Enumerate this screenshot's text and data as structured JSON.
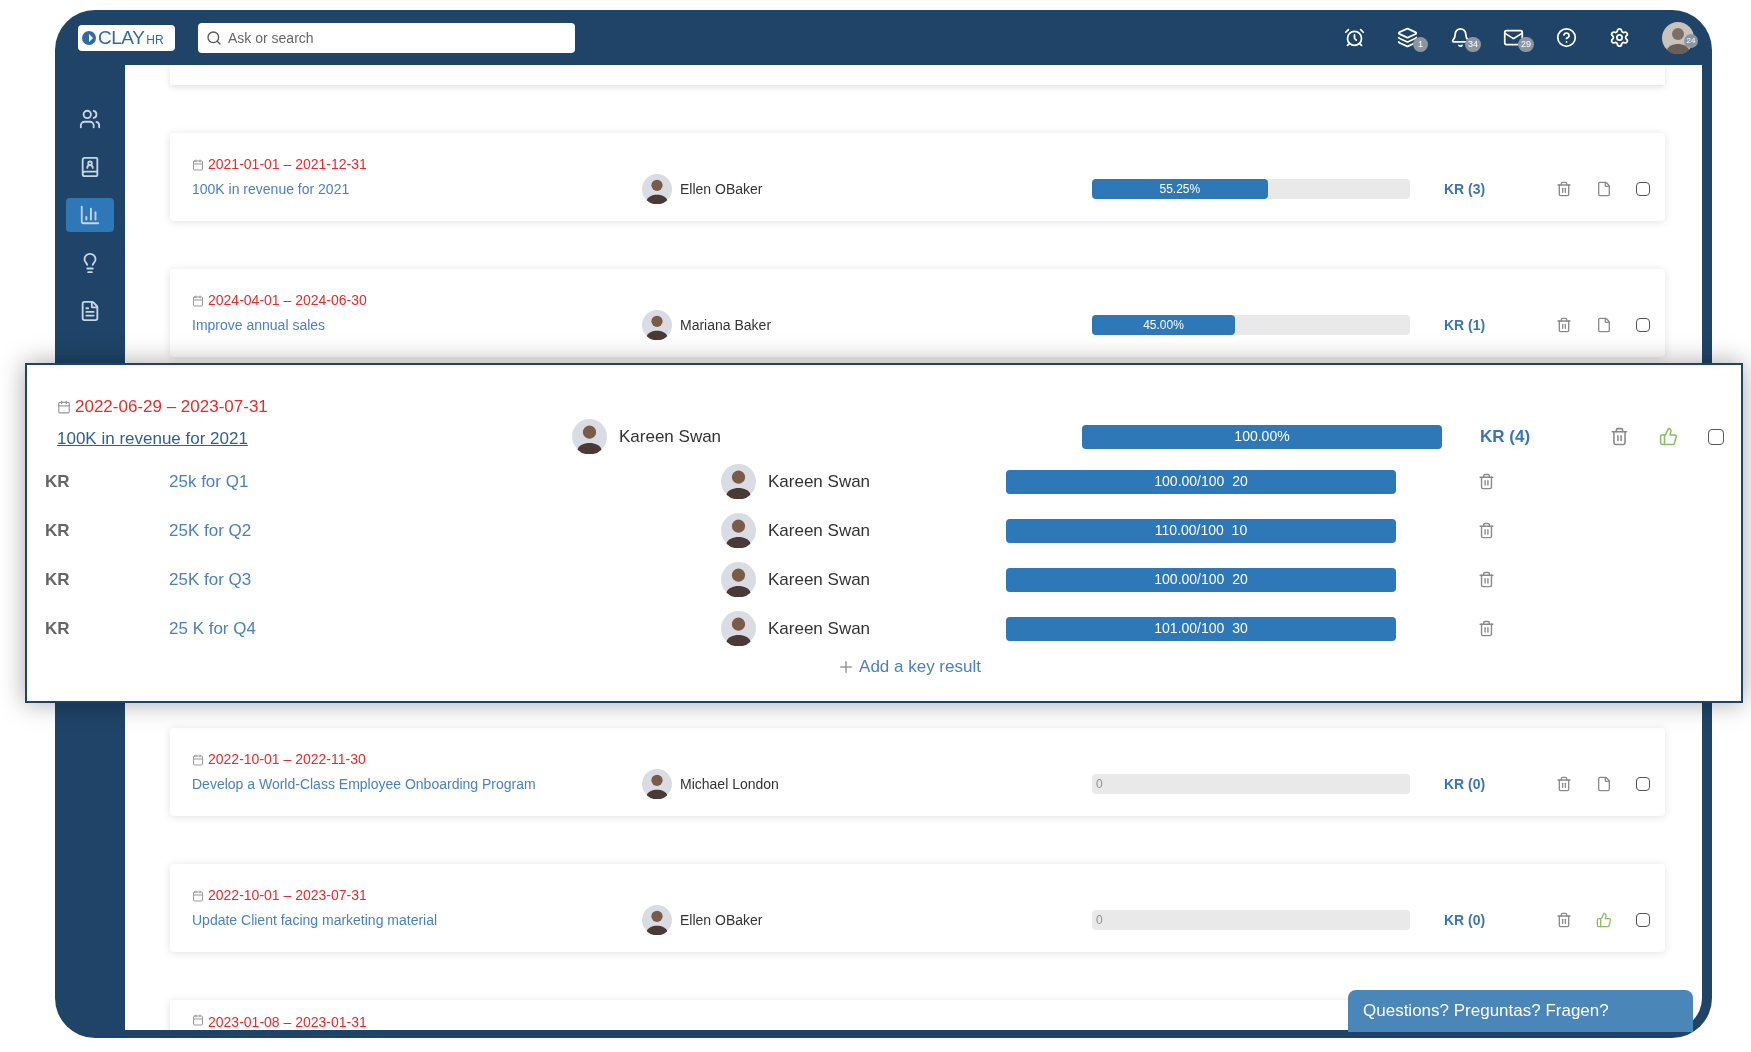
{
  "header": {
    "logo": {
      "name": "CLAY",
      "suffix": "HR"
    },
    "search": {
      "placeholder": "Ask or search"
    },
    "icons": [
      {
        "kind": "alarm"
      },
      {
        "kind": "layers",
        "badge": "1"
      },
      {
        "kind": "bell",
        "badge": "34"
      },
      {
        "kind": "mail",
        "badge": "29"
      },
      {
        "kind": "help"
      },
      {
        "kind": "settings"
      }
    ],
    "avatar_badge": "24"
  },
  "sidebar": {
    "items": [
      {
        "kind": "people",
        "selected": false
      },
      {
        "kind": "contacts",
        "selected": false
      },
      {
        "kind": "chart",
        "selected": true
      },
      {
        "kind": "idea",
        "selected": false
      },
      {
        "kind": "document",
        "selected": false
      }
    ]
  },
  "objectives_top": [
    {
      "date": "2021-01-01 – 2021-12-31",
      "title": "100K in revenue for 2021",
      "owner": "Ellen OBaker",
      "level": 0.5525,
      "progress": "55.25%",
      "kr": "KR (3)",
      "kind": "document",
      "checked": false
    },
    {
      "date": "2024-04-01 – 2024-06-30",
      "title": "Improve annual sales",
      "owner": "Mariana Baker",
      "level": 0.45,
      "progress": "45.00%",
      "kr": "KR (1)",
      "kind": "document",
      "checked": false
    }
  ],
  "expanded_objective": {
    "date": "2022-06-29 – 2023-07-31",
    "title": "100K in revenue for 2021",
    "owner": "Kareen Swan",
    "level": 1,
    "progress": "100.00%",
    "kr": "KR (4)",
    "kind": "like",
    "checked": false,
    "key_results": [
      {
        "tag": "KR",
        "title": "25k for Q1",
        "owner": "Kareen Swan",
        "level": 1,
        "progress": "100.00/100  20"
      },
      {
        "tag": "KR",
        "title": "25K for Q2",
        "owner": "Kareen Swan",
        "level": 1,
        "progress": "110.00/100  10"
      },
      {
        "tag": "KR",
        "title": "25K for Q3",
        "owner": "Kareen Swan",
        "level": 1,
        "progress": "100.00/100  20"
      },
      {
        "tag": "KR",
        "title": "25 K for Q4",
        "owner": "Kareen Swan",
        "level": 1,
        "progress": "101.00/100  30"
      }
    ],
    "add_label": "Add a key result"
  },
  "objectives_bottom": [
    {
      "date": "2022-10-01 – 2022-11-30",
      "title": "Develop a World-Class Employee Onboarding Program",
      "owner": "Michael London",
      "level": 0,
      "progress": "0",
      "kr": "KR (0)",
      "kind": "document",
      "checked": false
    },
    {
      "date": "2022-10-01 – 2023-07-31",
      "title": "Update Client facing marketing material",
      "owner": "Ellen OBaker",
      "level": 0,
      "progress": "0",
      "kr": "KR (0)",
      "kind": "like",
      "checked": false
    }
  ],
  "partial_objective": {
    "date": "2023-01-08 – 2023-01-31"
  },
  "chat_button": "Questions? Preguntas? Fragen?"
}
